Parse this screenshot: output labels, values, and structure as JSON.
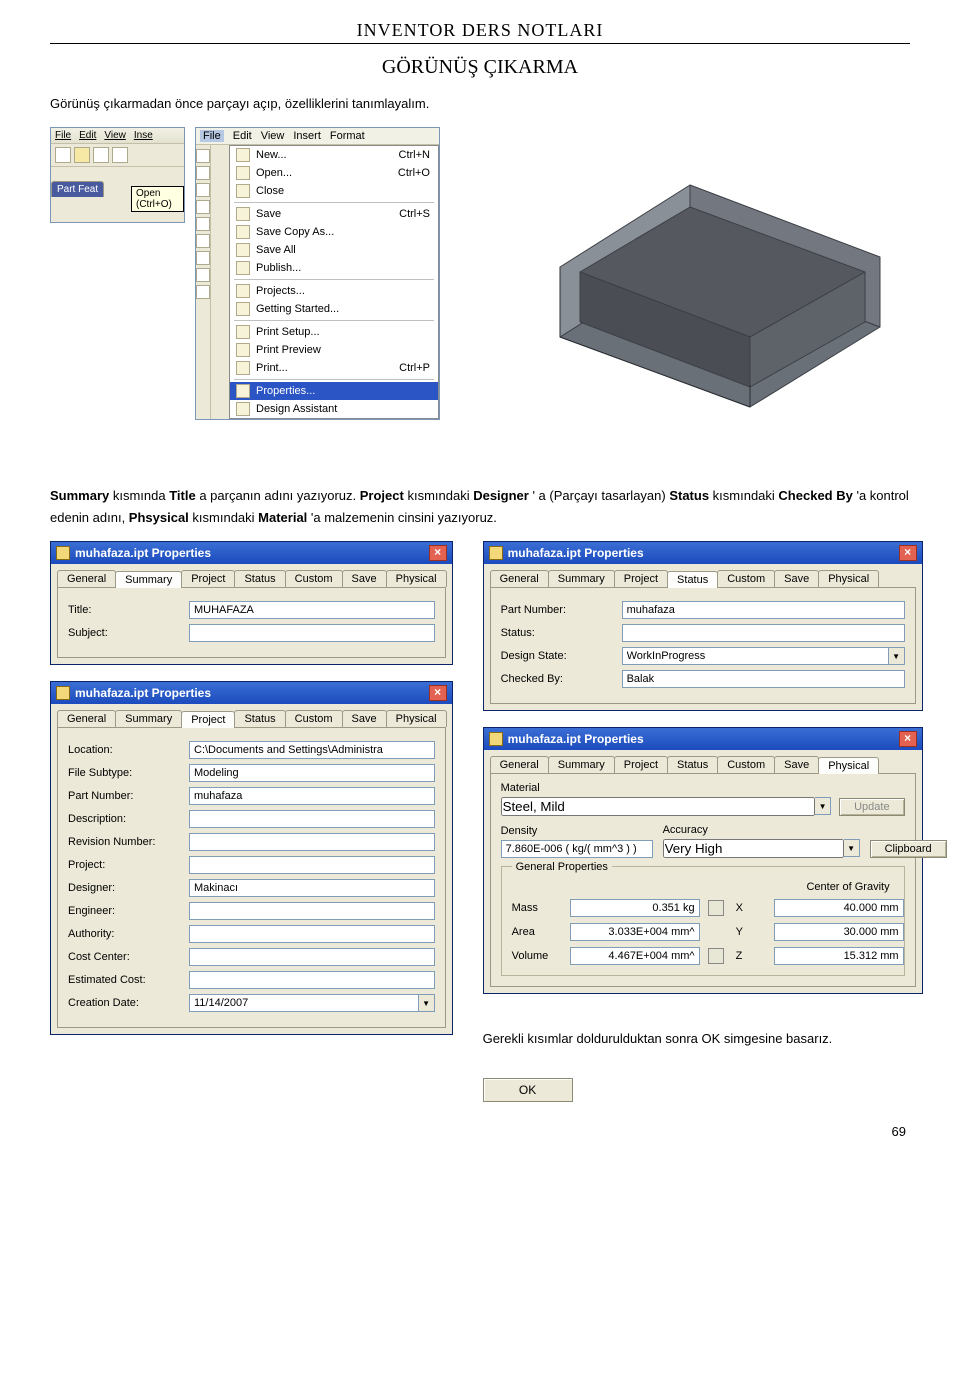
{
  "header": "INVENTOR DERS NOTLARI",
  "section_title": "GÖRÜNÜŞ ÇIKARMA",
  "intro": "Görünüş çıkarmadan önce parçayı açıp, özelliklerini tanımlayalım.",
  "mini": {
    "menus": [
      "File",
      "Edit",
      "View",
      "Inse"
    ],
    "part_label": "Part Feat",
    "tooltip": "Open (Ctrl+O)"
  },
  "filemenu": {
    "menubar": [
      "File",
      "Edit",
      "View",
      "Insert",
      "Format"
    ],
    "items": [
      {
        "label": "New...",
        "shortcut": "Ctrl+N"
      },
      {
        "label": "Open...",
        "shortcut": "Ctrl+O"
      },
      {
        "label": "Close",
        "shortcut": ""
      },
      {
        "sep": true
      },
      {
        "label": "Save",
        "shortcut": "Ctrl+S"
      },
      {
        "label": "Save Copy As...",
        "shortcut": ""
      },
      {
        "label": "Save All",
        "shortcut": ""
      },
      {
        "label": "Publish...",
        "shortcut": ""
      },
      {
        "sep": true
      },
      {
        "label": "Projects...",
        "shortcut": ""
      },
      {
        "label": "Getting Started...",
        "shortcut": ""
      },
      {
        "sep": true
      },
      {
        "label": "Print Setup...",
        "shortcut": ""
      },
      {
        "label": "Print Preview",
        "shortcut": ""
      },
      {
        "label": "Print...",
        "shortcut": "Ctrl+P"
      },
      {
        "sep": true
      },
      {
        "label": "Properties...",
        "shortcut": "",
        "selected": true
      },
      {
        "label": "Design Assistant",
        "shortcut": ""
      }
    ]
  },
  "para2_parts": {
    "t1": "Summary",
    "t2": " kısmında ",
    "t3": "Title",
    "t4": " a parçanın adını yazıyoruz.  ",
    "t5": "Project",
    "t6": " kısmındaki ",
    "t7": "Designer",
    "t8": " ' a (Parçayı tasarlayan) ",
    "t9": "Status",
    "t10": " kısmındaki ",
    "t11": "Checked By",
    "t12": " 'a kontrol edenin adını, ",
    "t13": "Phsysical",
    "t14": " kısmındaki ",
    "t15": "Material",
    "t16": " 'a malzemenin cinsini yazıyoruz."
  },
  "dialog_title": "muhafaza.ipt Properties",
  "tabs": [
    "General",
    "Summary",
    "Project",
    "Status",
    "Custom",
    "Save",
    "Physical"
  ],
  "summary": {
    "title_label": "Title:",
    "title_value": "MUHAFAZA",
    "subject_label": "Subject:",
    "subject_value": ""
  },
  "project": {
    "location_label": "Location:",
    "location_value": "C:\\Documents and Settings\\Administra",
    "filesubtype_label": "File Subtype:",
    "filesubtype_value": "Modeling",
    "partnumber_label": "Part Number:",
    "partnumber_value": "muhafaza",
    "description_label": "Description:",
    "description_value": "",
    "revision_label": "Revision Number:",
    "revision_value": "",
    "projectfield_label": "Project:",
    "projectfield_value": "",
    "designer_label": "Designer:",
    "designer_value": "Makinacı",
    "engineer_label": "Engineer:",
    "engineer_value": "",
    "authority_label": "Authority:",
    "authority_value": "",
    "costcenter_label": "Cost Center:",
    "costcenter_value": "",
    "estimatedcost_label": "Estimated Cost:",
    "estimatedcost_value": "",
    "creationdate_label": "Creation Date:",
    "creationdate_value": "11/14/2007"
  },
  "status": {
    "partnumber_label": "Part Number:",
    "partnumber_value": "muhafaza",
    "status_label": "Status:",
    "status_value": "",
    "designstate_label": "Design State:",
    "designstate_value": "WorkInProgress",
    "checkedby_label": "Checked By:",
    "checkedby_value": "Balak"
  },
  "physical": {
    "material_label": "Material",
    "material_value": "Steel, Mild",
    "update_btn": "Update",
    "clipboard_btn": "Clipboard",
    "density_label": "Density",
    "density_value": "7.860E-006 ( kg/( mm^3 ) )",
    "accuracy_label": "Accuracy",
    "accuracy_value": "Very High",
    "general_props_label": "General Properties",
    "cog_label": "Center of Gravity",
    "mass_label": "Mass",
    "mass_value": "0.351 kg",
    "area_label": "Area",
    "area_value": "3.033E+004 mm^",
    "volume_label": "Volume",
    "volume_value": "4.467E+004 mm^",
    "x_label": "X",
    "x_value": "40.000 mm",
    "y_label": "Y",
    "y_value": "30.000 mm",
    "z_label": "Z",
    "z_value": "15.312 mm"
  },
  "note_ok": "Gerekli kısımlar doldurulduktan sonra OK simgesine basarız.",
  "ok_label": "OK",
  "page_number": "69"
}
